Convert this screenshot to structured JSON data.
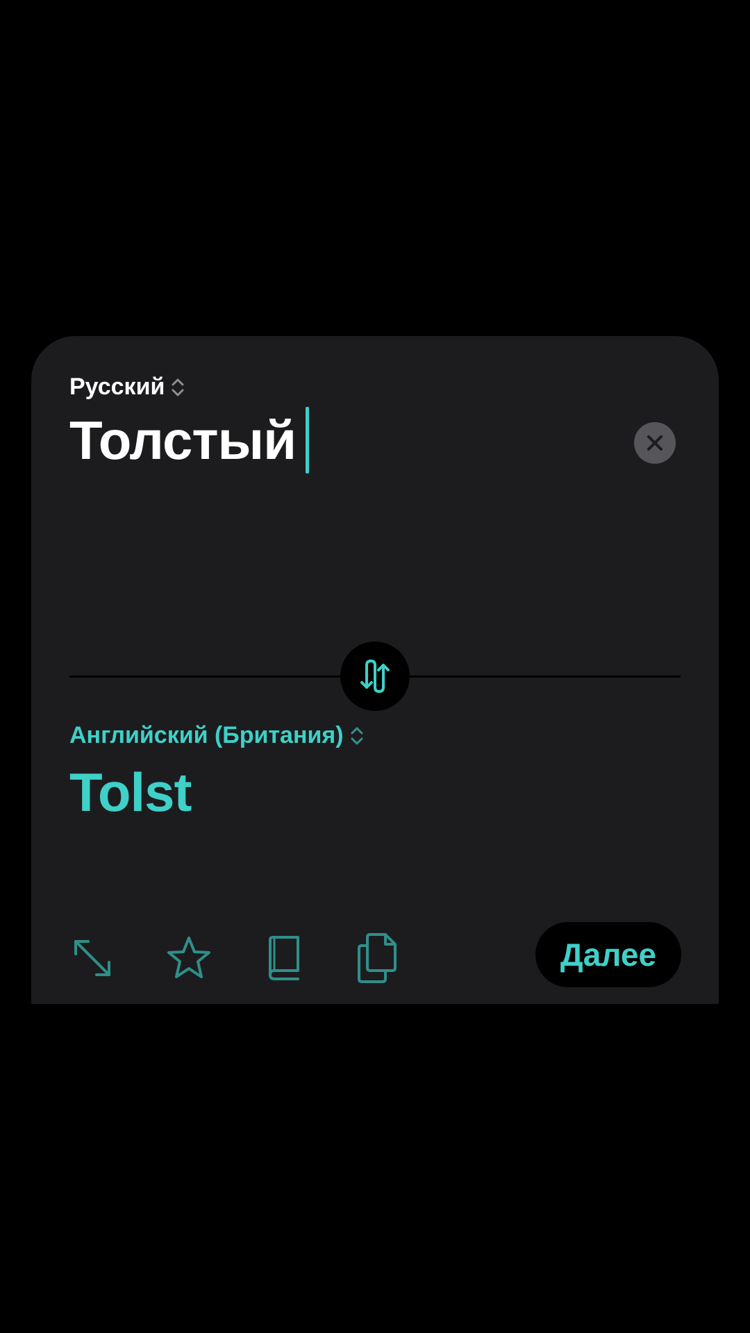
{
  "source": {
    "language": "Русский",
    "text": "Толстый"
  },
  "target": {
    "language": "Английский (Британия)",
    "text": "Tolst"
  },
  "toolbar": {
    "icons": [
      "expand-icon",
      "star-icon",
      "dictionary-book-icon",
      "copy-icon"
    ],
    "next_label": "Далее"
  },
  "colors": {
    "accent": "#3fd0c8",
    "card": "#1c1c1e",
    "background": "#000000",
    "clear_button": "#55555a"
  }
}
